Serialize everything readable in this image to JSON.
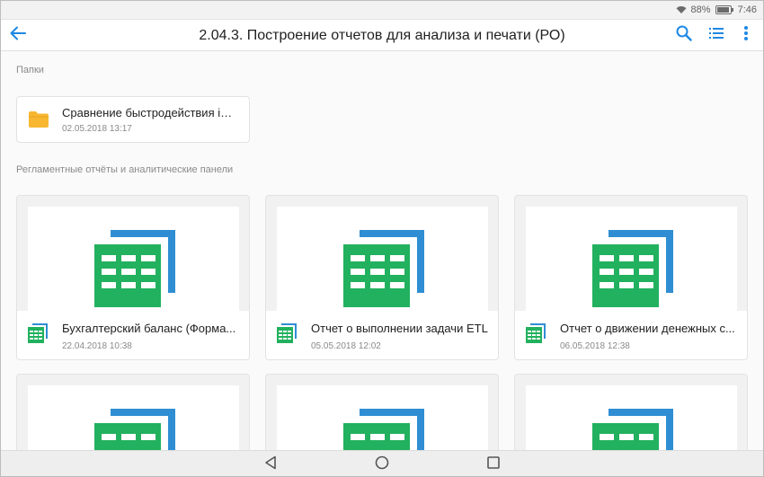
{
  "status_bar": {
    "battery": "88%",
    "time": "7:46"
  },
  "app_bar": {
    "title": "2.04.3. Построение отчетов для анализа и печати (РО)",
    "icons": [
      "back-arrow-icon",
      "search-icon",
      "list-view-icon",
      "more-vert-icon"
    ],
    "accent_color": "#1e88e5"
  },
  "folders_section": {
    "label": "Папки",
    "items": [
      {
        "title": "Сравнение быстродействия in-...",
        "date": "02.05.2018 13:17",
        "icon": "folder-icon"
      }
    ]
  },
  "reports_section": {
    "label": "Регламентные отчёты и аналитические панели",
    "items": [
      {
        "title": "Бухгалтерский баланс (Форма...",
        "date": "22.04.2018 10:38",
        "icon": "spreadsheet-icon"
      },
      {
        "title": "Отчет о выполнении задачи ETL",
        "date": "05.05.2018 12:02",
        "icon": "spreadsheet-icon"
      },
      {
        "title": "Отчет о движении денежных с...",
        "date": "06.05.2018 12:38",
        "icon": "spreadsheet-icon"
      }
    ]
  },
  "nav_bar": {
    "icons": [
      "back-triangle-icon",
      "home-circle-icon",
      "recents-square-icon"
    ]
  },
  "colors": {
    "sheet_green": "#22b15e",
    "sheet_blue": "#2f8ed3",
    "folder_yellow": "#f7b731"
  }
}
